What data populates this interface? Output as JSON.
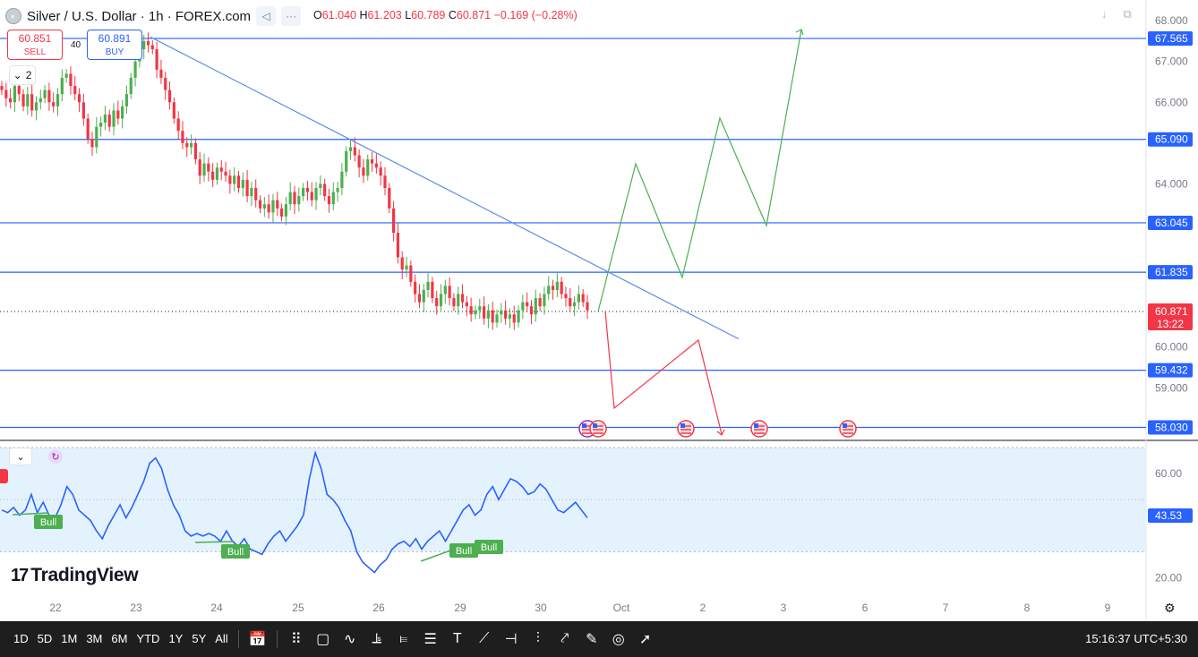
{
  "header": {
    "symbol_title": "Silver / U.S. Dollar · 1h · FOREX.com",
    "ohlc": {
      "open_label": "O",
      "open": "61.040",
      "high_label": "H",
      "high": "61.203",
      "low_label": "L",
      "low": "60.789",
      "close_label": "C",
      "close": "60.871",
      "change": "−0.169 (−0.28%)"
    }
  },
  "trade": {
    "sell_price": "60.851",
    "sell_label": "SELL",
    "spread": "40",
    "buy_price": "60.891",
    "buy_label": "BUY",
    "indicator_count": "2"
  },
  "colors": {
    "bull": "#26a69a",
    "bull_alt": "#4caf50",
    "bear": "#f23645",
    "level_line": "#2962ff",
    "trendline": "#5b8def",
    "rsi_line": "#2962ff",
    "rsi_band": "#e3f2fd",
    "projection_up": "#4caf50",
    "projection_down": "#f23645",
    "toolbar_bg": "#1e1e1e"
  },
  "chart_data": {
    "type": "candlestick",
    "price_axis_ticks": [
      "68.000",
      "67.000",
      "66.000",
      "64.000",
      "60.000",
      "59.000"
    ],
    "ylim": [
      57.8,
      68.2
    ],
    "x_ticks": [
      "22",
      "23",
      "24",
      "25",
      "26",
      "29",
      "30",
      "Oct",
      "2",
      "3",
      "6",
      "7",
      "8",
      "9"
    ],
    "horizontal_levels": [
      {
        "label": "67.565",
        "value": 67.565
      },
      {
        "label": "65.090",
        "value": 65.09
      },
      {
        "label": "63.045",
        "value": 63.045
      },
      {
        "label": "61.835",
        "value": 61.835
      },
      {
        "label": "59.432",
        "value": 59.432
      },
      {
        "label": "58.030",
        "value": 58.03
      }
    ],
    "current_price": {
      "label": "60.871",
      "countdown": "13:22",
      "value": 60.871
    },
    "trendline": {
      "from": {
        "x_day": "22.98",
        "price": 67.6
      },
      "to": {
        "x_day": "Oct 2.45",
        "price": 60.2
      }
    },
    "projection_up": [
      {
        "t": 0,
        "price": 60.95
      },
      {
        "t": 1,
        "price": 64.45
      },
      {
        "t": 2,
        "price": 61.8
      },
      {
        "t": 3,
        "price": 65.5
      },
      {
        "t": 4,
        "price": 63.0
      },
      {
        "t": 5,
        "price": 67.65
      }
    ],
    "projection_down": [
      {
        "t": 0,
        "price": 60.92
      },
      {
        "t": 1,
        "price": 58.6
      },
      {
        "t": 2,
        "price": 60.2
      },
      {
        "t": 3,
        "price": 58.03
      }
    ],
    "series_close": [
      66.3,
      66.1,
      66.0,
      66.4,
      66.2,
      65.9,
      66.2,
      65.8,
      66.0,
      66.1,
      66.3,
      66.0,
      65.9,
      66.2,
      66.6,
      66.7,
      66.4,
      66.2,
      66.0,
      65.6,
      65.1,
      64.9,
      65.4,
      65.5,
      65.7,
      65.4,
      65.8,
      65.6,
      65.9,
      66.2,
      66.6,
      67.0,
      67.3,
      67.5,
      67.4,
      67.3,
      66.8,
      66.6,
      66.3,
      66.0,
      65.6,
      65.3,
      65.0,
      64.9,
      65.0,
      64.6,
      64.2,
      64.5,
      64.3,
      64.1,
      64.4,
      64.3,
      64.2,
      64.0,
      64.2,
      63.9,
      64.1,
      63.7,
      63.9,
      63.6,
      63.4,
      63.5,
      63.3,
      63.6,
      63.4,
      63.2,
      63.5,
      63.8,
      63.5,
      63.7,
      63.9,
      63.8,
      63.6,
      63.9,
      64.0,
      63.7,
      63.5,
      63.8,
      63.9,
      64.3,
      64.8,
      64.9,
      64.7,
      64.4,
      64.2,
      64.6,
      64.5,
      64.4,
      64.2,
      63.9,
      63.4,
      62.8,
      62.2,
      61.9,
      62.0,
      61.6,
      61.3,
      61.1,
      61.4,
      61.6,
      61.2,
      61.0,
      61.3,
      61.5,
      61.2,
      61.0,
      61.3,
      61.1,
      61.0,
      60.8,
      60.9,
      61.0,
      60.7,
      60.9,
      60.6,
      60.8,
      60.9,
      60.7,
      60.8,
      60.6,
      60.9,
      61.1,
      61.0,
      60.8,
      61.2,
      61.0,
      61.3,
      61.5,
      61.4,
      61.6,
      61.3,
      61.2,
      61.0,
      61.1,
      61.3,
      61.1,
      60.9
    ],
    "rsi": {
      "value_label": "43.53",
      "ticks": [
        "60.00",
        "20.00"
      ],
      "ylim": [
        15,
        70
      ],
      "band": [
        30,
        70
      ],
      "divergence_labels": [
        "Bull",
        "Bull",
        "Bull",
        "Bull"
      ],
      "values": [
        46,
        45,
        47,
        44,
        46,
        52,
        45,
        49,
        44,
        43,
        48,
        55,
        52,
        46,
        44,
        42,
        38,
        35,
        40,
        44,
        48,
        43,
        47,
        52,
        57,
        64,
        66,
        62,
        54,
        48,
        44,
        38,
        36,
        37,
        36,
        37,
        36,
        34,
        38,
        34,
        32,
        35,
        31,
        30,
        29,
        33,
        36,
        38,
        34,
        37,
        40,
        44,
        58,
        68,
        62,
        52,
        50,
        47,
        42,
        38,
        30,
        26,
        24,
        22,
        25,
        27,
        31,
        33,
        34,
        32,
        35,
        31,
        34,
        36,
        38,
        34,
        38,
        42,
        46,
        48,
        44,
        46,
        52,
        55,
        50,
        54,
        58,
        57,
        55,
        52,
        53,
        56,
        54,
        50,
        46,
        45,
        47,
        49,
        46,
        43
      ]
    }
  },
  "toolbar": {
    "timeframes": [
      "1D",
      "5D",
      "1M",
      "3M",
      "6M",
      "YTD",
      "1Y",
      "5Y",
      "All"
    ],
    "clock": "15:16:37 UTC+5:30"
  },
  "branding": {
    "logo_text": "TradingView"
  }
}
